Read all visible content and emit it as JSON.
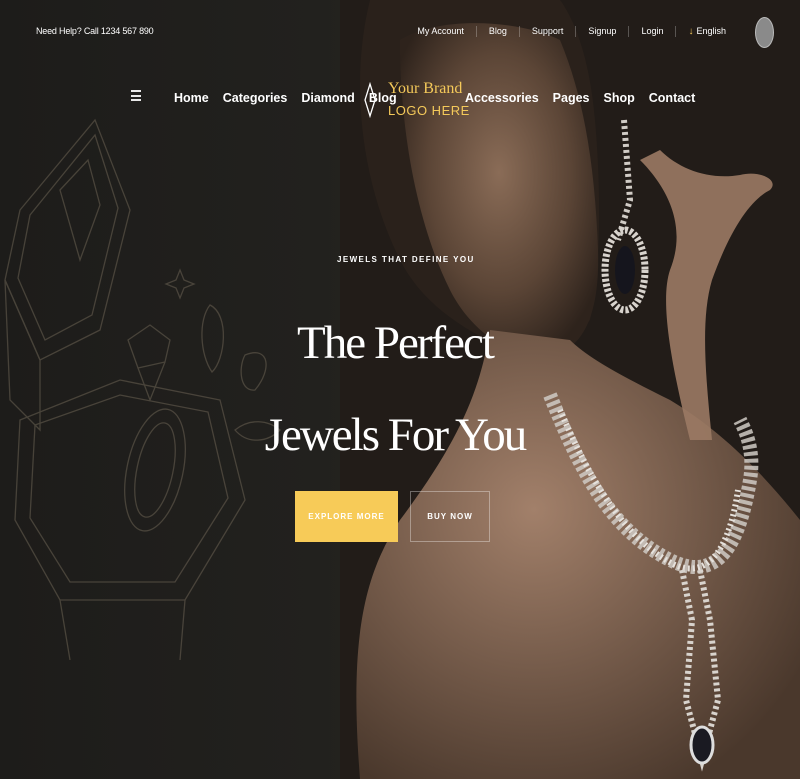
{
  "topbar": {
    "help": "Need Help? Call 1234 567 890",
    "links": [
      "My Account",
      "Blog",
      "Support",
      "Signup",
      "Login"
    ],
    "language": "English"
  },
  "nav": {
    "left": [
      "Home",
      "Categories",
      "Diamond",
      "Blog"
    ],
    "right": [
      "Accessories",
      "Pages",
      "Shop",
      "Contact"
    ],
    "brand_line1": "Your Brand",
    "brand_line2": "LOGO HERE"
  },
  "hero": {
    "tagline": "JEWELS THAT DEFINE YOU",
    "headline_line1": "The Perfect",
    "headline_line2": "Jewels For You",
    "explore_label": "EXPLORE MORE",
    "buy_label": "BUY NOW"
  },
  "colors": {
    "accent": "#f7cb58",
    "background": "#1b1a18",
    "text": "#ffffff"
  }
}
